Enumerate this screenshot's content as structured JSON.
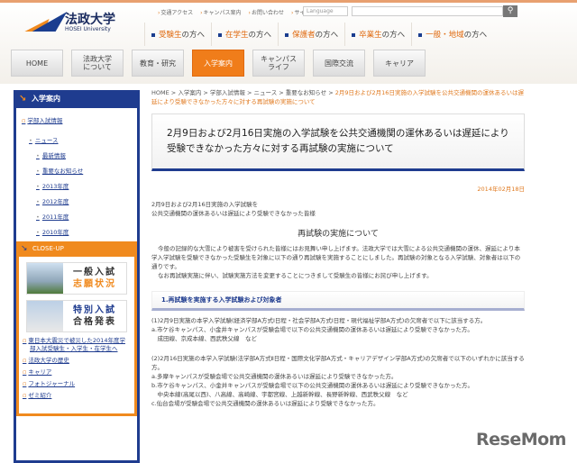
{
  "logo": {
    "jp": "法政大学",
    "en": "HOSEI University"
  },
  "util_links": [
    "交通アクセス",
    "キャンパス案内",
    "お問い合わせ",
    "サイトマップ"
  ],
  "language_label": "Language",
  "audience": [
    {
      "hl": "受験生",
      "rest": "の方へ"
    },
    {
      "hl": "在学生",
      "rest": "の方へ"
    },
    {
      "hl": "保護者",
      "rest": "の方へ"
    },
    {
      "hl": "卒業生",
      "rest": "の方へ"
    },
    {
      "hl": "一般・地域",
      "rest": "の方へ"
    }
  ],
  "gnav": [
    "HOME",
    "法政大学\nについて",
    "教育・研究",
    "入学案内",
    "キャンパス\nライフ",
    "国際交流",
    "キャリア"
  ],
  "sidebar": {
    "title": "入学案内",
    "l1": "学部入試情報",
    "l2": "ニュース",
    "l3": [
      "最新情報",
      "重要なお知らせ",
      "2013年度",
      "2012年度",
      "2011年度",
      "2010年度"
    ],
    "closeup": {
      "title": "CLOSE-UP",
      "banner1": [
        "一般入試",
        "志願状況"
      ],
      "banner2": [
        "特別入試",
        "合格発表"
      ],
      "links": [
        "東日本大震災で被災した2014年度学部入試受験生・入学生・在学生へ",
        "法政大学の歴史",
        "キャリア",
        "フォトジャーナル",
        "ゼミ紹介"
      ]
    }
  },
  "breadcrumb": {
    "items": [
      "HOME",
      "入学案内",
      "学部入試情報",
      "ニュース",
      "重要なお知らせ"
    ],
    "current": "2月9日および2月16日実施の入学試験を公共交通機関の運休あるいは遅延により受験できなかった方々に対する再試験の実施について"
  },
  "title": "2月9日および2月16日実施の入学試験を公共交通機関の運休あるいは遅延により受験できなかった方々に対する再試験の実施について",
  "date": "2014年02月18日",
  "intro": [
    "2月9日および2月16日実施の入学試験を",
    "公共交通機関の運休あるいは遅延により受験できなかった皆様"
  ],
  "heading": "再試験の実施について",
  "paragraphs": [
    "今般の記録的な大雪により被害を受けられた皆様にはお見舞い申し上げます。法政大学では大雪による公共交通機関の運休、遅延により本学入学試験を受験できなかった受験生を対象に以下の通り再試験を実施することにしました。再試験の対象となる入学試験、対象者は以下の通りです。",
    "なお再試験実施に伴い、試験実施方法を変更することにつきまして受験生の皆様にお詫び申し上げます。"
  ],
  "section1": {
    "title": "1.再試験を実施する入学試験および対象者",
    "lines": [
      "(1)2月9日実施の本学入学試験(経済学部A方式Ⅰ日程・社会学部A方式Ⅰ日程・現代福祉学部A方式)の欠席者で以下に該当する方。",
      "a.市ケ谷キャンパス、小金井キャンパスが受験会場で以下の公共交通機関の運休あるいは遅延により受験できなかった方。",
      "　成田線、京成本線、西武秩父線　など",
      "",
      "(2)2月16日実施の本学入学試験(法学部A方式Ⅱ日程・国際文化学部A方式・キャリアデザイン学部A方式)の欠席者で以下のいずれかに該当する方。",
      "a.多摩キャンパスが受験会場で公共交通機関の運休あるいは遅延により受験できなかった方。",
      "b.市ケ谷キャンパス、小金井キャンパスが受験会場で以下の公共交通機関の運休あるいは遅延により受験できなかった方。",
      "　中央本線(高尾以西)、八高線、高崎線、宇都宮線、上越新幹線、長野新幹線、西武秩父線　など",
      "c.仙台会場が受験会場で公共交通機関の運休あるいは遅延により受験できなかった方。"
    ]
  },
  "watermark": "ReseMom"
}
